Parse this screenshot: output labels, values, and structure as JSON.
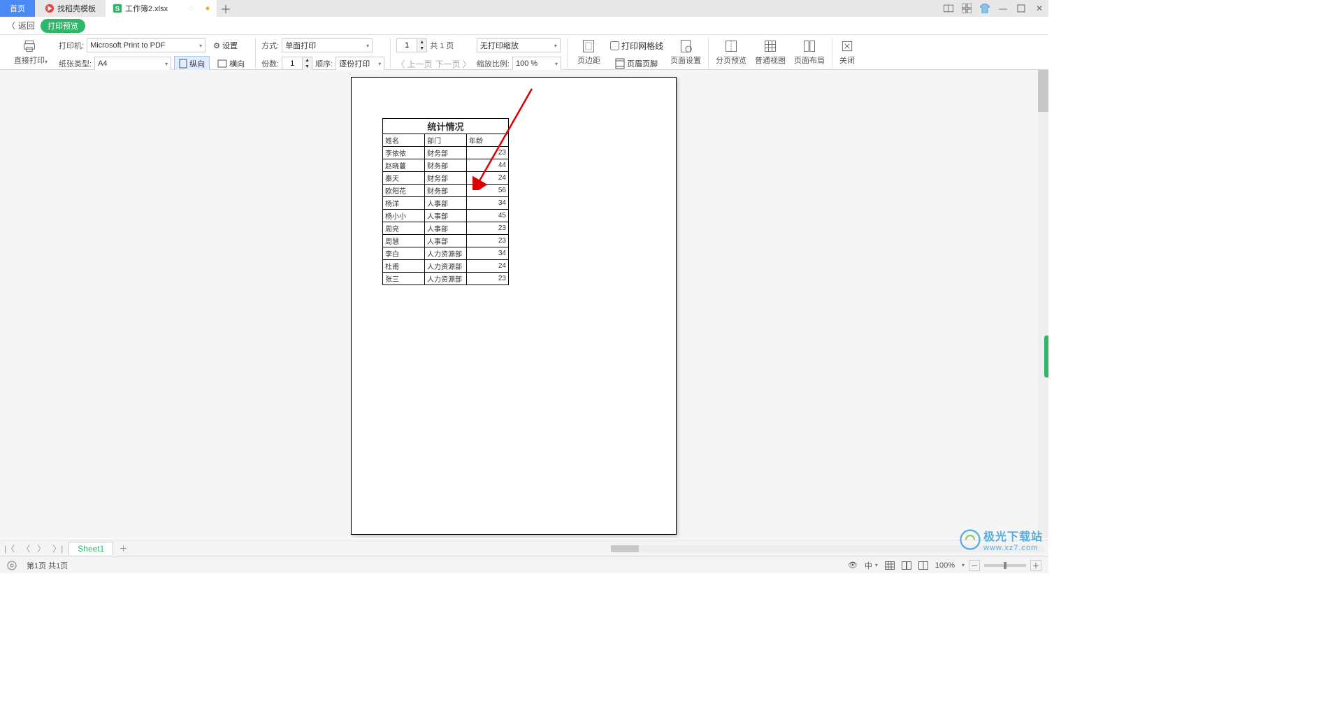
{
  "tabs": {
    "home": "首页",
    "templates": "找稻壳模板",
    "doc": "工作簿2.xlsx"
  },
  "nav": {
    "back": "返回",
    "badge": "打印预览"
  },
  "toolbar": {
    "direct_print": "直接打印",
    "printer_label": "打印机:",
    "printer_value": "Microsoft Print to PDF",
    "settings": "设置",
    "paper_label": "纸张类型:",
    "paper_value": "A4",
    "portrait": "纵向",
    "landscape": "横向",
    "method_label": "方式:",
    "method_value": "单面打印",
    "copies_label": "份数:",
    "copies_value": "1",
    "order_label": "顺序:",
    "order_value": "逐份打印",
    "page_input_value": "1",
    "page_count_text": "共 1 页",
    "prev_page": "上一页",
    "next_page": "下一页",
    "scale_label": "无打印缩放",
    "ratio_label": "缩放比例:",
    "ratio_value": "100 %",
    "margin": "页边距",
    "gridlines": "打印网格线",
    "header_footer": "页眉页脚",
    "page_setup": "页面设置",
    "break_preview": "分页预览",
    "normal_view": "普通视图",
    "page_layout": "页面布局",
    "close": "关闭"
  },
  "sheet": {
    "name": "Sheet1"
  },
  "status": {
    "page_info": "第1页 共1页",
    "lang": "中",
    "zoom": "100%"
  },
  "watermark": {
    "line1": "极光下载站",
    "line2": "www.xz7.com"
  },
  "chart_data": {
    "type": "table",
    "title": "统计情况",
    "columns": [
      "姓名",
      "部门",
      "年龄"
    ],
    "rows": [
      [
        "李依依",
        "财务部",
        23
      ],
      [
        "赵晓蔓",
        "财务部",
        44
      ],
      [
        "秦天",
        "财务部",
        24
      ],
      [
        "欧阳花",
        "财务部",
        56
      ],
      [
        "杨洋",
        "人事部",
        34
      ],
      [
        "杨小小",
        "人事部",
        45
      ],
      [
        "周亮",
        "人事部",
        23
      ],
      [
        "周慧",
        "人事部",
        23
      ],
      [
        "李白",
        "人力资源部",
        34
      ],
      [
        "杜甫",
        "人力资源部",
        24
      ],
      [
        "张三",
        "人力资源部",
        23
      ]
    ]
  }
}
